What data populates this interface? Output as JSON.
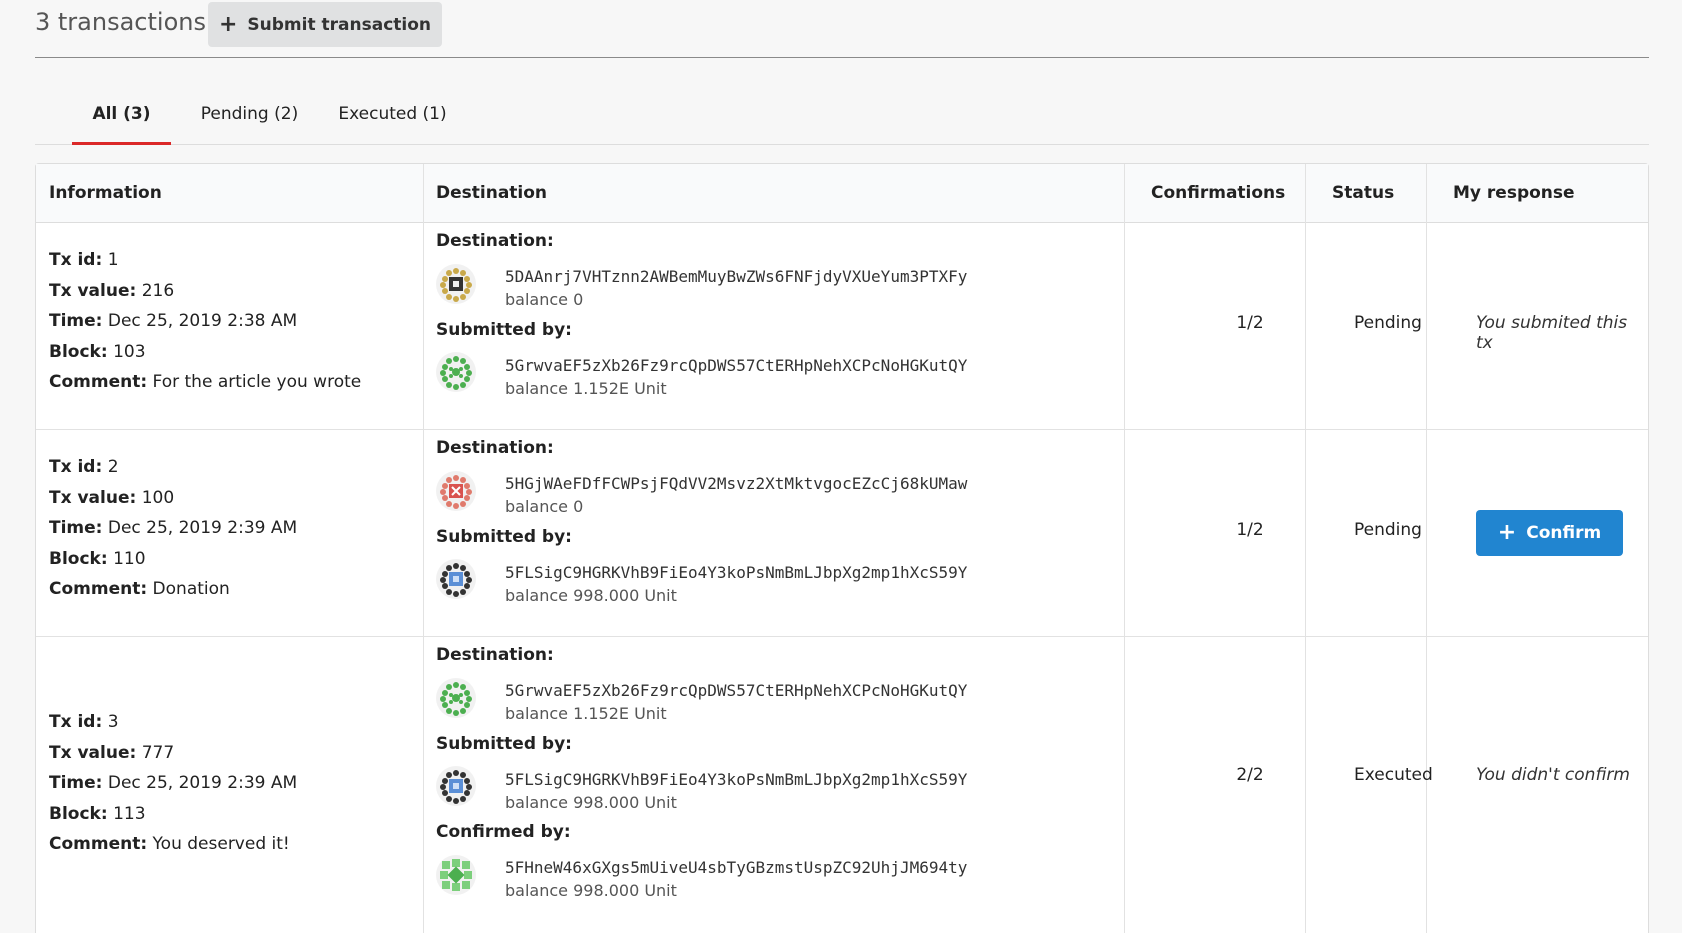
{
  "header": {
    "title": "3 transactions",
    "submit_label": "Submit transaction"
  },
  "tabs": [
    {
      "label": "All (3)"
    },
    {
      "label": "Pending (2)"
    },
    {
      "label": "Executed (1)"
    }
  ],
  "table": {
    "headers": [
      "Information",
      "Destination",
      "Confirmations",
      "Status",
      "My response"
    ],
    "labels": {
      "tx_id": "Tx id:",
      "tx_value": "Tx value:",
      "time": "Time:",
      "block": "Block:",
      "comment": "Comment:",
      "destination": "Destination:",
      "submitted_by": "Submitted by:",
      "confirmed_by": "Confirmed by:"
    },
    "rows": [
      {
        "tx_id": "1",
        "tx_value": "216",
        "time": "Dec 25, 2019 2:38 AM",
        "block": "103",
        "comment": "For the article you wrote",
        "destination": {
          "address": "5DAAnrj7VHTznn2AWBemMuyBwZWs6FNFjdyVXUeYum3PTXFy",
          "balance": "balance 0",
          "icon": "identicon-gold-icon"
        },
        "submitted_by": {
          "address": "5GrwvaEF5zXb26Fz9rcQpDWS57CtERHpNehXCPcNoHGKutQY",
          "balance": "balance 1.152E Unit",
          "icon": "identicon-green-icon"
        },
        "confirmations": "1/2",
        "status": "Pending",
        "response": "You submited this tx"
      },
      {
        "tx_id": "2",
        "tx_value": "100",
        "time": "Dec 25, 2019 2:39 AM",
        "block": "110",
        "comment": "Donation",
        "destination": {
          "address": "5HGjWAeFDfFCWPsjFQdVV2Msvz2XtMktvgocEZcCj68kUMaw",
          "balance": "balance 0",
          "icon": "identicon-red-icon"
        },
        "submitted_by": {
          "address": "5FLSigC9HGRKVhB9FiEo4Y3koPsNmBmLJbpXg2mp1hXcS59Y",
          "balance": "balance 998.000 Unit",
          "icon": "identicon-blue-icon"
        },
        "confirmations": "1/2",
        "status": "Pending",
        "confirm_label": "Confirm"
      },
      {
        "tx_id": "3",
        "tx_value": "777",
        "time": "Dec 25, 2019 2:39 AM",
        "block": "113",
        "comment": "You deserved it!",
        "destination": {
          "address": "5GrwvaEF5zXb26Fz9rcQpDWS57CtERHpNehXCPcNoHGKutQY",
          "balance": "balance 1.152E Unit",
          "icon": "identicon-green-icon"
        },
        "submitted_by": {
          "address": "5FLSigC9HGRKVhB9FiEo4Y3koPsNmBmLJbpXg2mp1hXcS59Y",
          "balance": "balance 998.000 Unit",
          "icon": "identicon-blue-icon"
        },
        "confirmed_by": {
          "address": "5FHneW46xGXgs5mUiveU4sbTyGBzmstUspZC92UhjJM694ty",
          "balance": "balance 998.000 Unit",
          "icon": "identicon-lightgreen-icon"
        },
        "confirmations": "2/2",
        "status": "Executed",
        "response": "You didn't confirm"
      }
    ]
  },
  "colors": {
    "accent_tab": "#db2828",
    "primary_button": "#2185d0"
  }
}
